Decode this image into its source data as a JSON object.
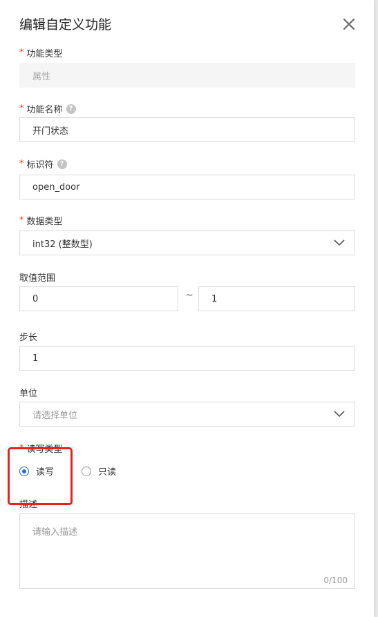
{
  "dialog": {
    "title": "编辑自定义功能"
  },
  "fields": {
    "function_type": {
      "label": "功能类型",
      "value": "属性"
    },
    "function_name": {
      "label": "功能名称",
      "value": "开门状态"
    },
    "identifier": {
      "label": "标识符",
      "value": "open_door"
    },
    "data_type": {
      "label": "数据类型",
      "value": "int32 (整数型)"
    },
    "value_range": {
      "label": "取值范围",
      "min": "0",
      "separator": "~",
      "max": "1"
    },
    "step": {
      "label": "步长",
      "value": "1"
    },
    "unit": {
      "label": "单位",
      "placeholder": "请选择单位"
    },
    "rw_type": {
      "label": "读写类型",
      "options": [
        {
          "label": "读写",
          "selected": true
        },
        {
          "label": "只读",
          "selected": false
        }
      ]
    },
    "description": {
      "label": "描述",
      "placeholder": "请输入描述",
      "counter": "0/100"
    }
  },
  "colors": {
    "required": "#e5473a",
    "accent": "#1e6fd9",
    "highlight": "#e8211b"
  },
  "icons": {
    "close": "close-icon",
    "help": "help-icon",
    "dropdown": "chevron-down-icon"
  }
}
